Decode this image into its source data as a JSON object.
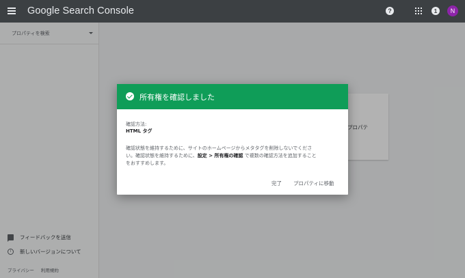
{
  "app": {
    "title": "Google Search Console"
  },
  "header": {
    "help_glyph": "?",
    "notifications_count": "1",
    "avatar_initial": "N"
  },
  "sidebar": {
    "property_search_placeholder": "プロパティを検索",
    "feedback_label": "フィードバックを送信",
    "new_version_label": "新しいバージョンについて",
    "info_glyph": "i",
    "privacy_link": "プライバシー",
    "terms_link": "利用規約"
  },
  "background_card": {
    "text": "プロパテ"
  },
  "dialog": {
    "title": "所有権を確認しました",
    "method_label": "確認方法:",
    "method_value": "HTML タグ",
    "description_line1": "確認状態を維持するために、サイトのホームページからメタタグを削除しないでくださ",
    "description_line2_pre": "い。確認状態を維持するために、",
    "description_line2_bold": "設定 > 所有権の確認",
    "description_line2_post": " で複数の確認方法を追加すること",
    "description_line3": "をおすすめします。",
    "done_label": "完了",
    "goto_property_label": "プロパティに移動"
  },
  "colors": {
    "topbar": "#3c4043",
    "header_green": "#0f9d58",
    "avatar": "#8e24aa"
  }
}
